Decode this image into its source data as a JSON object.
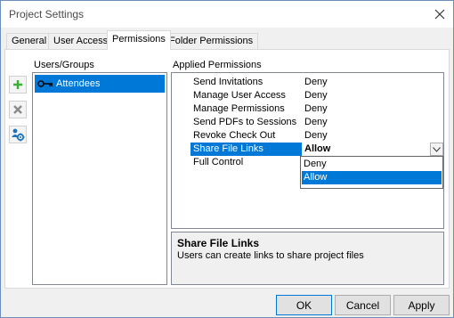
{
  "window": {
    "title": "Project Settings",
    "close_icon": "close-icon"
  },
  "tabs": [
    {
      "label": "General"
    },
    {
      "label": "User Access"
    },
    {
      "label": "Permissions",
      "active": true
    },
    {
      "label": "Folder Permissions"
    }
  ],
  "users": {
    "label": "Users/Groups",
    "items": [
      {
        "label": "Attendees",
        "icon": "key-icon",
        "selected": true
      }
    ],
    "toolbar": [
      {
        "icon": "add-icon",
        "color": "#3cb034"
      },
      {
        "icon": "remove-icon",
        "color": "#8a8a8a"
      },
      {
        "icon": "user-settings-icon",
        "color": "#1e73be"
      }
    ]
  },
  "permissions": {
    "label": "Applied Permissions",
    "rows": [
      {
        "name": "Send Invitations",
        "value": "Deny"
      },
      {
        "name": "Manage User Access",
        "value": "Deny"
      },
      {
        "name": "Manage Permissions",
        "value": "Deny"
      },
      {
        "name": "Send PDFs to Sessions",
        "value": "Deny"
      },
      {
        "name": "Revoke Check Out",
        "value": "Deny"
      },
      {
        "name": "Share File Links",
        "value": "Allow",
        "selected": true
      },
      {
        "name": "Full Control",
        "value": ""
      }
    ],
    "dropdown_options": [
      {
        "label": "Deny"
      },
      {
        "label": "Allow",
        "highlighted": true
      }
    ]
  },
  "description": {
    "title": "Share File Links",
    "text": "Users can create links to share project files"
  },
  "buttons": {
    "ok": "OK",
    "cancel": "Cancel",
    "apply": "Apply"
  },
  "colors": {
    "accent": "#0078d7"
  }
}
